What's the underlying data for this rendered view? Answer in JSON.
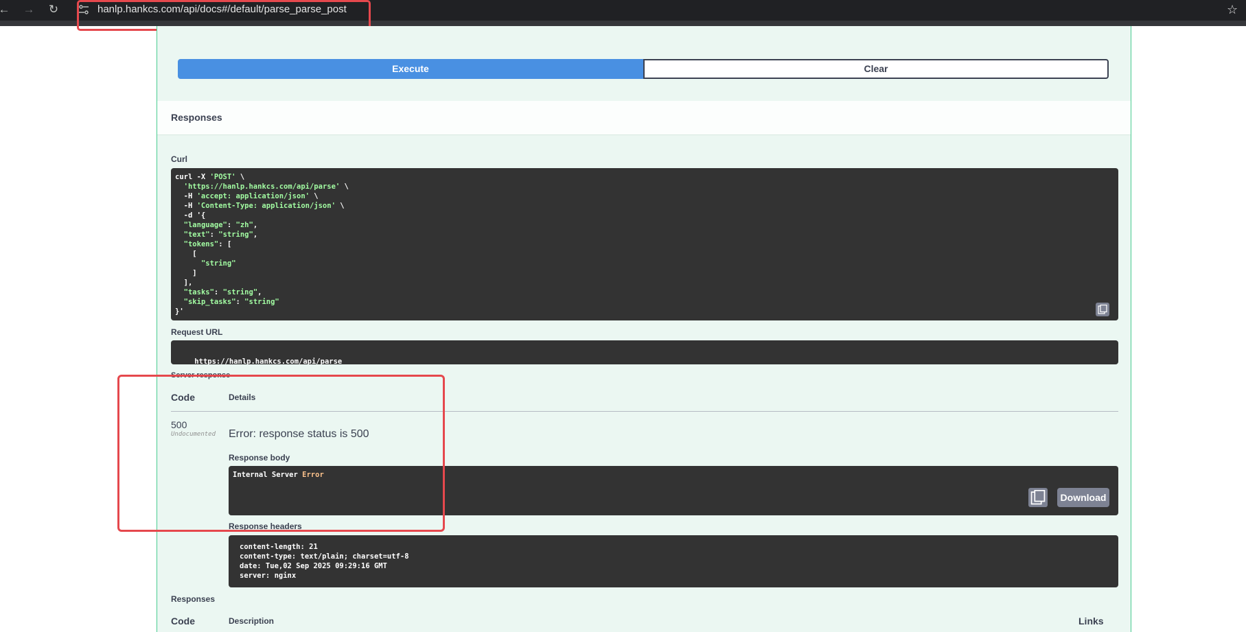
{
  "browser": {
    "back_icon": "arrow-left-icon",
    "forward_icon": "arrow-right-icon",
    "reload_icon": "reload-icon",
    "url": "hanlp.hankcs.com/api/docs#/default/parse_parse_post",
    "bookmark_icon": "star-icon"
  },
  "actions": {
    "execute_label": "Execute",
    "clear_label": "Clear"
  },
  "responses_title": "Responses",
  "curl": {
    "label": "Curl",
    "lines": [
      "curl -X 'POST' \\",
      "  'https://hanlp.hankcs.com/api/parse' \\",
      "  -H 'accept: application/json' \\",
      "  -H 'Content-Type: application/json' \\",
      "  -d '{",
      "  \"language\": \"zh\",",
      "  \"text\": \"string\",",
      "  \"tokens\": [",
      "    [",
      "      \"string\"",
      "    ]",
      "  ],",
      "  \"tasks\": \"string\",",
      "  \"skip_tasks\": \"string\"",
      "}'"
    ]
  },
  "request_url": {
    "label": "Request URL",
    "value": "https://hanlp.hankcs.com/api/parse"
  },
  "server_response": {
    "label": "Server response",
    "code_header": "Code",
    "details_header": "Details",
    "code": "500",
    "undocumented": "Undocumented",
    "error": "Error: response status is 500",
    "body_label": "Response body",
    "body_text_plain": "Internal Server ",
    "body_text_highlight": "Error",
    "download_label": "Download",
    "headers_label": "Response headers",
    "headers": [
      "content-length: 21",
      "content-type: text/plain; charset=utf-8",
      "date: Tue,02 Sep 2025 09:29:16 GMT",
      "server: nginx"
    ]
  },
  "responses_table": {
    "title": "Responses",
    "code_header": "Code",
    "description_header": "Description",
    "links_header": "Links"
  },
  "colors": {
    "execute": "#4990e2",
    "block_bg": "#ebf7f2",
    "block_border": "#49cc90",
    "highlight_box": "#e5484d"
  }
}
